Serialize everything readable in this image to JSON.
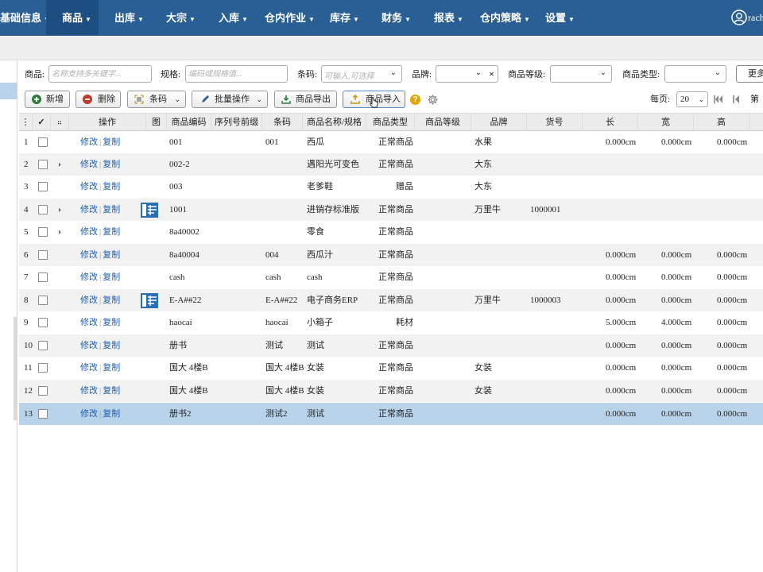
{
  "nav": {
    "items": [
      {
        "label": "基础信息"
      },
      {
        "label": "商品",
        "active": true
      },
      {
        "label": "出库"
      },
      {
        "label": "大宗"
      },
      {
        "label": "入库"
      },
      {
        "label": "仓内作业"
      },
      {
        "label": "库存"
      },
      {
        "label": "财务"
      },
      {
        "label": "报表"
      },
      {
        "label": "仓内策略"
      },
      {
        "label": "设置"
      }
    ],
    "user_name": "rach"
  },
  "filters": {
    "product_label": "商品:",
    "product_placeholder": "名称支持多关键字...",
    "spec_label": "规格:",
    "spec_placeholder": "编码或规格值...",
    "barcode_label": "条码:",
    "barcode_placeholder": "可输入,可选择",
    "brand_label": "品牌:",
    "grade_label": "商品等级:",
    "type_label": "商品类型:",
    "more_label": "更多"
  },
  "toolbar": {
    "add": "新增",
    "delete": "删除",
    "barcode": "条码",
    "batch": "批量操作",
    "export": "商品导出",
    "import": "商品导入",
    "per_page_label": "每页:",
    "per_page_value": "20",
    "page_label": "第"
  },
  "grid": {
    "columns": [
      "操作",
      "图",
      "商品编码",
      "序列号前缀",
      "条码",
      "商品名称/规格",
      "商品类型",
      "商品等级",
      "品牌",
      "货号",
      "长",
      "宽",
      "高"
    ],
    "edit": "修改",
    "copy": "复制",
    "rows": [
      {
        "no": "1",
        "expand": false,
        "img": false,
        "code": "001",
        "serial": "",
        "barcode": "001",
        "name": "西瓜",
        "type": "正常商品",
        "grade": "",
        "brand": "水果",
        "item_no": "",
        "len": "0.000cm",
        "wid": "0.000cm",
        "hei": "0.000cm"
      },
      {
        "no": "2",
        "expand": true,
        "img": false,
        "code": "002-2",
        "serial": "",
        "barcode": "",
        "name": "遇阳光可变色",
        "type": "正常商品",
        "grade": "",
        "brand": "大东",
        "item_no": "",
        "len": "",
        "wid": "",
        "hei": ""
      },
      {
        "no": "3",
        "expand": false,
        "img": false,
        "code": "003",
        "serial": "",
        "barcode": "",
        "name": "老爹鞋",
        "type": "赠品",
        "grade": "",
        "brand": "大东",
        "item_no": "",
        "len": "",
        "wid": "",
        "hei": ""
      },
      {
        "no": "4",
        "expand": true,
        "img": true,
        "code": "1001",
        "serial": "",
        "barcode": "",
        "name": "进销存标准版",
        "type": "正常商品",
        "grade": "",
        "brand": "万里牛",
        "item_no": "1000001",
        "len": "",
        "wid": "",
        "hei": ""
      },
      {
        "no": "5",
        "expand": true,
        "img": false,
        "code": "8a40002",
        "serial": "",
        "barcode": "",
        "name": "零食",
        "type": "正常商品",
        "grade": "",
        "brand": "",
        "item_no": "",
        "len": "",
        "wid": "",
        "hei": ""
      },
      {
        "no": "6",
        "expand": false,
        "img": false,
        "code": "8a40004",
        "serial": "",
        "barcode": "004",
        "name": "西瓜汁",
        "type": "正常商品",
        "grade": "",
        "brand": "",
        "item_no": "",
        "len": "0.000cm",
        "wid": "0.000cm",
        "hei": "0.000cm"
      },
      {
        "no": "7",
        "expand": false,
        "img": false,
        "code": "cash",
        "serial": "",
        "barcode": "cash",
        "name": "cash",
        "type": "正常商品",
        "grade": "",
        "brand": "",
        "item_no": "",
        "len": "0.000cm",
        "wid": "0.000cm",
        "hei": "0.000cm"
      },
      {
        "no": "8",
        "expand": false,
        "img": true,
        "code": "E-A##22",
        "serial": "",
        "barcode": "E-A##22",
        "name": "电子商务ERP",
        "type": "正常商品",
        "grade": "",
        "brand": "万里牛",
        "item_no": "1000003",
        "len": "0.000cm",
        "wid": "0.000cm",
        "hei": "0.000cm"
      },
      {
        "no": "9",
        "expand": false,
        "img": false,
        "code": "haocai",
        "serial": "",
        "barcode": "haocai",
        "name": "小箱子",
        "type": "耗材",
        "grade": "",
        "brand": "",
        "item_no": "",
        "len": "5.000cm",
        "wid": "4.000cm",
        "hei": "0.000cm"
      },
      {
        "no": "10",
        "expand": false,
        "img": false,
        "code": "册书",
        "serial": "",
        "barcode": "测试",
        "name": "测试",
        "type": "正常商品",
        "grade": "",
        "brand": "",
        "item_no": "",
        "len": "0.000cm",
        "wid": "0.000cm",
        "hei": "0.000cm"
      },
      {
        "no": "11",
        "expand": false,
        "img": false,
        "code": "国大 4楼B",
        "serial": "",
        "barcode": "国大 4楼B",
        "name": "女装",
        "type": "正常商品",
        "grade": "",
        "brand": "女装",
        "item_no": "",
        "len": "0.000cm",
        "wid": "0.000cm",
        "hei": "0.000cm"
      },
      {
        "no": "12",
        "expand": false,
        "img": false,
        "code": "国大 4楼B",
        "serial": "",
        "barcode": "国大 4楼B",
        "name": "女装",
        "type": "正常商品",
        "grade": "",
        "brand": "女装",
        "item_no": "",
        "len": "0.000cm",
        "wid": "0.000cm",
        "hei": "0.000cm"
      },
      {
        "no": "13",
        "expand": false,
        "img": false,
        "code": "册书2",
        "serial": "",
        "barcode": "测试2",
        "name": "测试",
        "type": "正常商品",
        "grade": "",
        "brand": "",
        "item_no": "",
        "len": "0.000cm",
        "wid": "0.000cm",
        "hei": "0.000cm",
        "selected": true
      }
    ]
  },
  "colors": {
    "nav_bg": "#2a5f95",
    "nav_active": "#1d4e82",
    "link": "#1f5fb0",
    "selected_row": "#b9d3ea",
    "help_icon": "#e3a600"
  }
}
